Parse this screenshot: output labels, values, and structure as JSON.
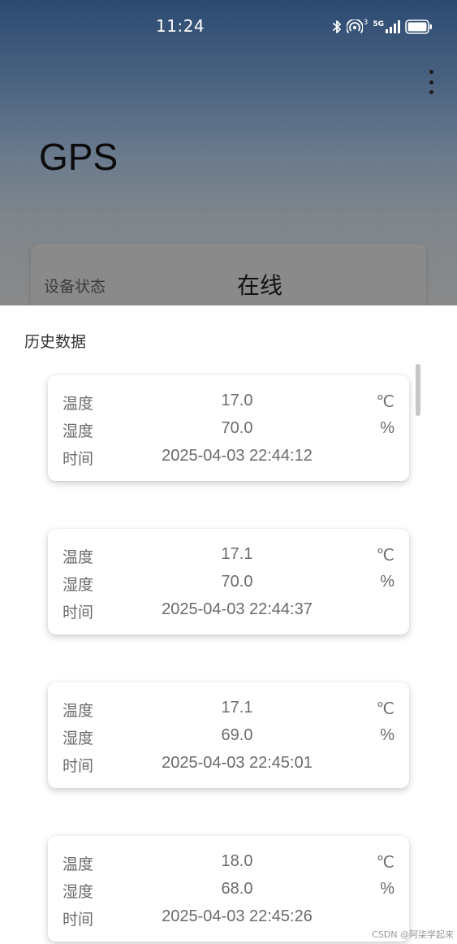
{
  "status_bar": {
    "time": "11:24",
    "network_label": "5G",
    "hotspot_badge": "3",
    "icons": [
      "bluetooth-icon",
      "hotspot-icon",
      "cellular-signal-icon",
      "battery-icon"
    ]
  },
  "app": {
    "title": "GPS",
    "menu_icon": "more-vert-icon",
    "device_status": {
      "label": "设备状态",
      "value": "在线"
    }
  },
  "history": {
    "title": "历史数据",
    "records": [
      {
        "temp_label": "温度",
        "temp_value": "17.0",
        "temp_unit": "℃",
        "hum_label": "湿度",
        "hum_value": "70.0",
        "hum_unit": "%",
        "time_label": "时间",
        "time_value": "2025-04-03 22:44:12"
      },
      {
        "temp_label": "温度",
        "temp_value": "17.1",
        "temp_unit": "℃",
        "hum_label": "湿度",
        "hum_value": "70.0",
        "hum_unit": "%",
        "time_label": "时间",
        "time_value": "2025-04-03 22:44:37"
      },
      {
        "temp_label": "温度",
        "temp_value": "17.1",
        "temp_unit": "℃",
        "hum_label": "湿度",
        "hum_value": "69.0",
        "hum_unit": "%",
        "time_label": "时间",
        "time_value": "2025-04-03 22:45:01"
      },
      {
        "temp_label": "温度",
        "temp_value": "18.0",
        "temp_unit": "℃",
        "hum_label": "湿度",
        "hum_value": "68.0",
        "hum_unit": "%",
        "time_label": "时间",
        "time_value": "2025-04-03 22:45:26"
      }
    ]
  },
  "watermark": "CSDN @阿柒学起来"
}
